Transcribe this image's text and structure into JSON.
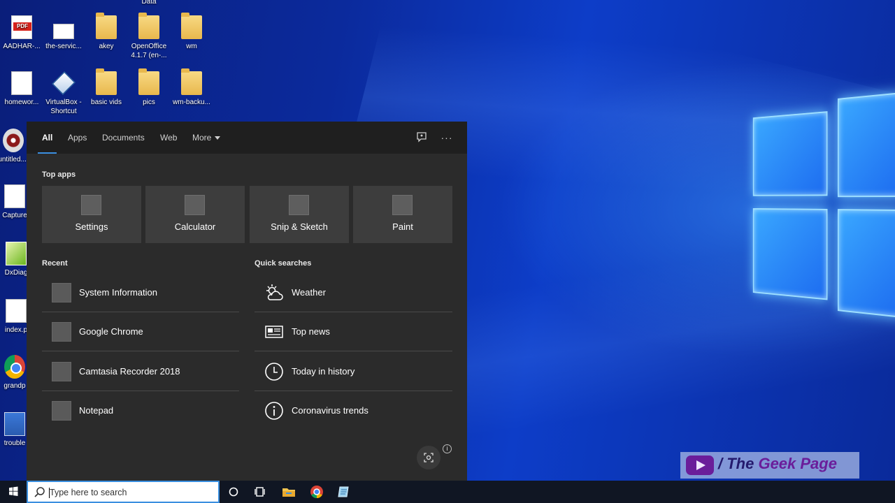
{
  "desktop": {
    "icons": [
      {
        "label": "Data"
      },
      {
        "label": "AADHAR-..."
      },
      {
        "label": "the-servic..."
      },
      {
        "label": "akey"
      },
      {
        "label": "OpenOffice 4.1.7 (en-..."
      },
      {
        "label": "wm"
      },
      {
        "label": "homewor..."
      },
      {
        "label": "VirtualBox - Shortcut"
      },
      {
        "label": "basic vids"
      },
      {
        "label": "pics"
      },
      {
        "label": "wm-backu..."
      },
      {
        "label": "untitled...."
      },
      {
        "label": "Capture"
      },
      {
        "label": "DxDiag"
      },
      {
        "label": "index.p"
      },
      {
        "label": "grandp"
      },
      {
        "label": "trouble"
      }
    ]
  },
  "search_panel": {
    "tabs": [
      {
        "label": "All",
        "active": true
      },
      {
        "label": "Apps"
      },
      {
        "label": "Documents"
      },
      {
        "label": "Web"
      },
      {
        "label": "More"
      }
    ],
    "top_apps_title": "Top apps",
    "top_apps": [
      {
        "label": "Settings"
      },
      {
        "label": "Calculator"
      },
      {
        "label": "Snip & Sketch"
      },
      {
        "label": "Paint"
      }
    ],
    "recent_title": "Recent",
    "recent": [
      {
        "label": "System Information"
      },
      {
        "label": "Google Chrome"
      },
      {
        "label": "Camtasia Recorder 2018"
      },
      {
        "label": "Notepad"
      }
    ],
    "quick_title": "Quick searches",
    "quick": [
      {
        "label": "Weather",
        "icon": "weather-icon"
      },
      {
        "label": "Top news",
        "icon": "news-icon"
      },
      {
        "label": "Today in history",
        "icon": "clock-icon"
      },
      {
        "label": "Coronavirus trends",
        "icon": "info-icon"
      }
    ]
  },
  "taskbar": {
    "search_placeholder": "Type here to search"
  },
  "watermark": {
    "prefix": "/ The ",
    "brand": "Geek Page"
  },
  "colors": {
    "accent": "#3a8fe0",
    "panel_bg": "#2b2b2b",
    "tile_bg": "#3d3d3d"
  }
}
